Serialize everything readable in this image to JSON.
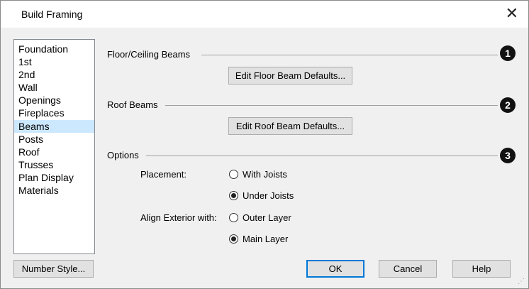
{
  "window": {
    "title": "Build Framing",
    "close_glyph": "✕"
  },
  "sidebar": {
    "items": [
      {
        "label": "Foundation"
      },
      {
        "label": "1st"
      },
      {
        "label": "2nd"
      },
      {
        "label": "Wall"
      },
      {
        "label": "Openings"
      },
      {
        "label": "Fireplaces"
      },
      {
        "label": "Beams"
      },
      {
        "label": "Posts"
      },
      {
        "label": "Roof"
      },
      {
        "label": "Trusses"
      },
      {
        "label": "Plan Display"
      },
      {
        "label": "Materials"
      }
    ],
    "selected": "Beams"
  },
  "sections": {
    "floor_ceiling": {
      "label": "Floor/Ceiling Beams",
      "badge": "1",
      "button": "Edit Floor Beam Defaults..."
    },
    "roof": {
      "label": "Roof Beams",
      "badge": "2",
      "button": "Edit Roof Beam Defaults..."
    },
    "options": {
      "label": "Options",
      "badge": "3",
      "placement_label": "Placement:",
      "placement": [
        {
          "label": "With Joists",
          "checked": false
        },
        {
          "label": "Under Joists",
          "checked": true
        }
      ],
      "align_label": "Align Exterior with:",
      "align": [
        {
          "label": "Outer Layer",
          "checked": false
        },
        {
          "label": "Main Layer",
          "checked": true
        }
      ]
    }
  },
  "footer": {
    "number_style": "Number Style...",
    "ok": "OK",
    "cancel": "Cancel",
    "help": "Help"
  },
  "colors": {
    "selection": "#cce8ff",
    "default_button_border": "#0078d7"
  }
}
